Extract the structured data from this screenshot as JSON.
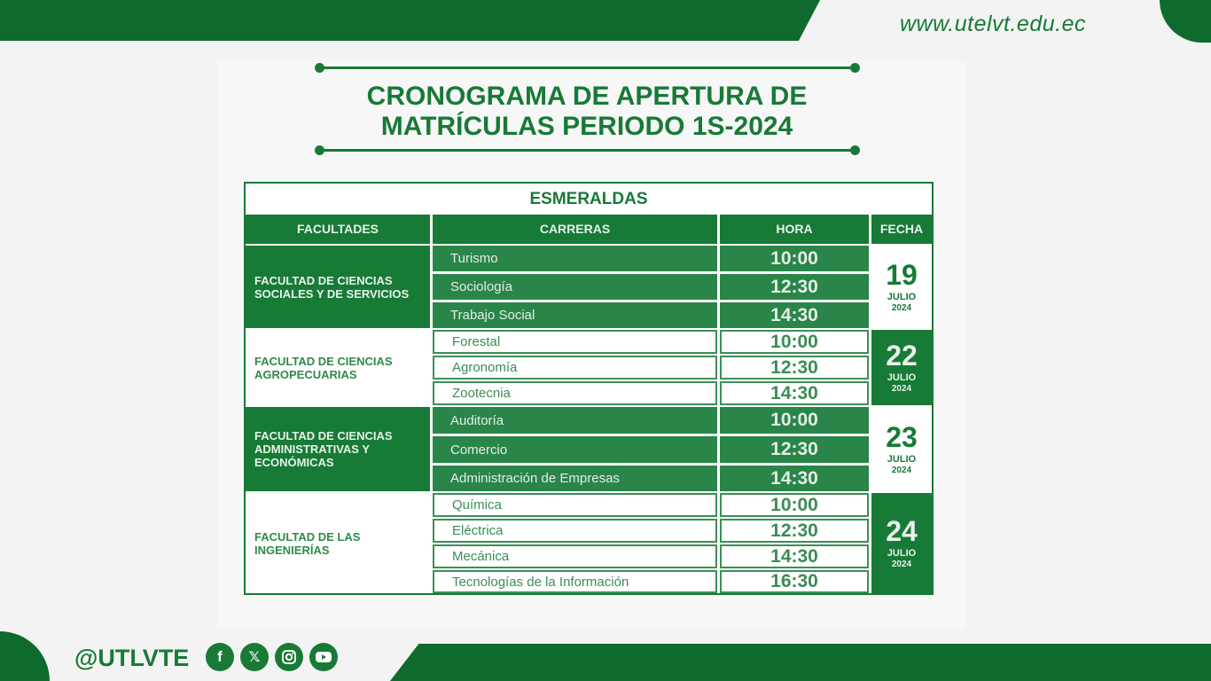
{
  "website": "www.utelvt.edu.ec",
  "title": {
    "line1": "CRONOGRAMA DE APERTURA DE",
    "line2": "MATRÍCULAS PERIODO 1S-2024"
  },
  "table": {
    "campus": "ESMERALDAS",
    "headers": {
      "facultades": "FACULTADES",
      "carreras": "CARRERAS",
      "hora": "HORA",
      "fecha": "FECHA"
    },
    "groups": [
      {
        "faculty": "FACULTAD DE CIENCIAS SOCIALES Y DE SERVICIOS",
        "day": "19",
        "month": "JULIO",
        "year": "2024",
        "rows": [
          {
            "career": "Turismo",
            "hour": "10:00"
          },
          {
            "career": "Sociología",
            "hour": "12:30"
          },
          {
            "career": "Trabajo Social",
            "hour": "14:30"
          }
        ]
      },
      {
        "faculty": "FACULTAD DE CIENCIAS AGROPECUARIAS",
        "day": "22",
        "month": "JULIO",
        "year": "2024",
        "rows": [
          {
            "career": "Forestal",
            "hour": "10:00"
          },
          {
            "career": "Agronomía",
            "hour": "12:30"
          },
          {
            "career": "Zootecnia",
            "hour": "14:30"
          }
        ]
      },
      {
        "faculty": "FACULTAD DE CIENCIAS ADMINISTRATIVAS Y ECONÓMICAS",
        "day": "23",
        "month": "JULIO",
        "year": "2024",
        "rows": [
          {
            "career": "Auditoría",
            "hour": "10:00"
          },
          {
            "career": "Comercio",
            "hour": "12:30"
          },
          {
            "career": "Administración de Empresas",
            "hour": "14:30"
          }
        ]
      },
      {
        "faculty": "FACULTAD DE LAS INGENIERÍAS",
        "day": "24",
        "month": "JULIO",
        "year": "2024",
        "rows": [
          {
            "career": "Química",
            "hour": "10:00"
          },
          {
            "career": "Eléctrica",
            "hour": "12:30"
          },
          {
            "career": "Mecánica",
            "hour": "14:30"
          },
          {
            "career": "Tecnologías de la Información",
            "hour": "16:30"
          }
        ]
      }
    ]
  },
  "footer": {
    "handle": "@UTLVTE",
    "social_icons": [
      "facebook-icon",
      "x-icon",
      "instagram-icon",
      "youtube-icon"
    ],
    "brand_green": "#177a36"
  }
}
